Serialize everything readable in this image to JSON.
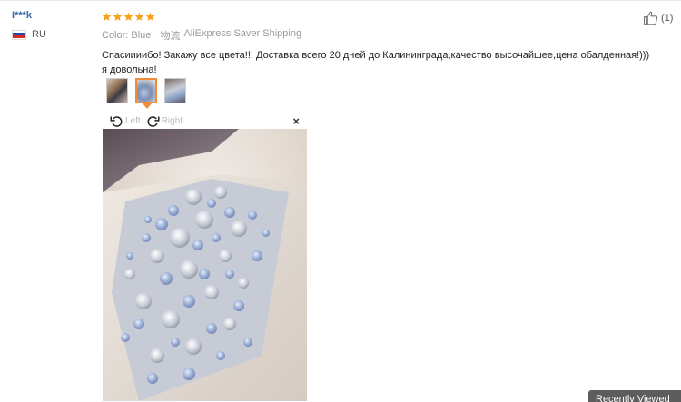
{
  "review": {
    "user_name": "I***k",
    "country": "RU",
    "rating": 5,
    "color_label": "Color:",
    "color_value": "Blue",
    "shipping_label": "物流",
    "shipping_value": "AliExpress Saver Shipping",
    "text": "Спасиииибо! Закажу все цвета!!! Доставка всего 20 дней до Калининграда,качество высочайшее,цена обалденная!))) я довольна!",
    "likes": "(1)"
  },
  "viewer": {
    "rotate_left_label": "Left",
    "rotate_right_label": "Right",
    "close_symbol": "×"
  },
  "footer": {
    "recent_label": "Recently Viewed"
  },
  "colors": {
    "star": "#f7a21b",
    "link": "#3366aa",
    "active_thumb": "#f08b3a"
  }
}
